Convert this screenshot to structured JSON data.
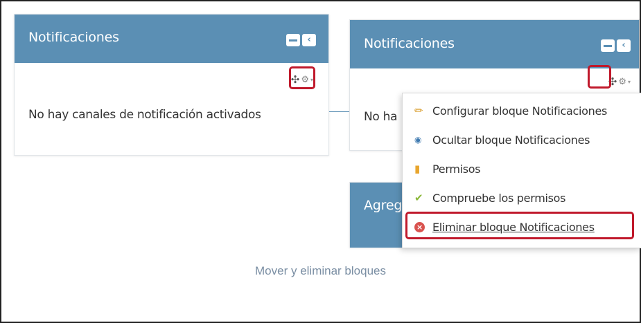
{
  "left_block": {
    "title": "Notificaciones",
    "body": "No hay canales de notificación activados",
    "min_icon": "minus-icon",
    "dock_icon": "chevron-left-icon"
  },
  "right_block": {
    "title": "Notificaciones",
    "body_partial": "No ha"
  },
  "second_block": {
    "title_partial": "Agreg"
  },
  "menu": {
    "items": [
      {
        "label": "Configurar bloque Notificaciones",
        "icon": "pencil-icon"
      },
      {
        "label": "Ocultar bloque Notificaciones",
        "icon": "eye-icon"
      },
      {
        "label": "Permisos",
        "icon": "shield-icon"
      },
      {
        "label": "Compruebe los permisos",
        "icon": "check-shield-icon"
      },
      {
        "label": "Eliminar bloque Notificaciones",
        "icon": "remove-icon"
      }
    ]
  },
  "caption": "Mover y eliminar bloques",
  "colors": {
    "header": "#5b8fb4",
    "highlight": "#c0192b",
    "caption": "#7a8ea3"
  }
}
